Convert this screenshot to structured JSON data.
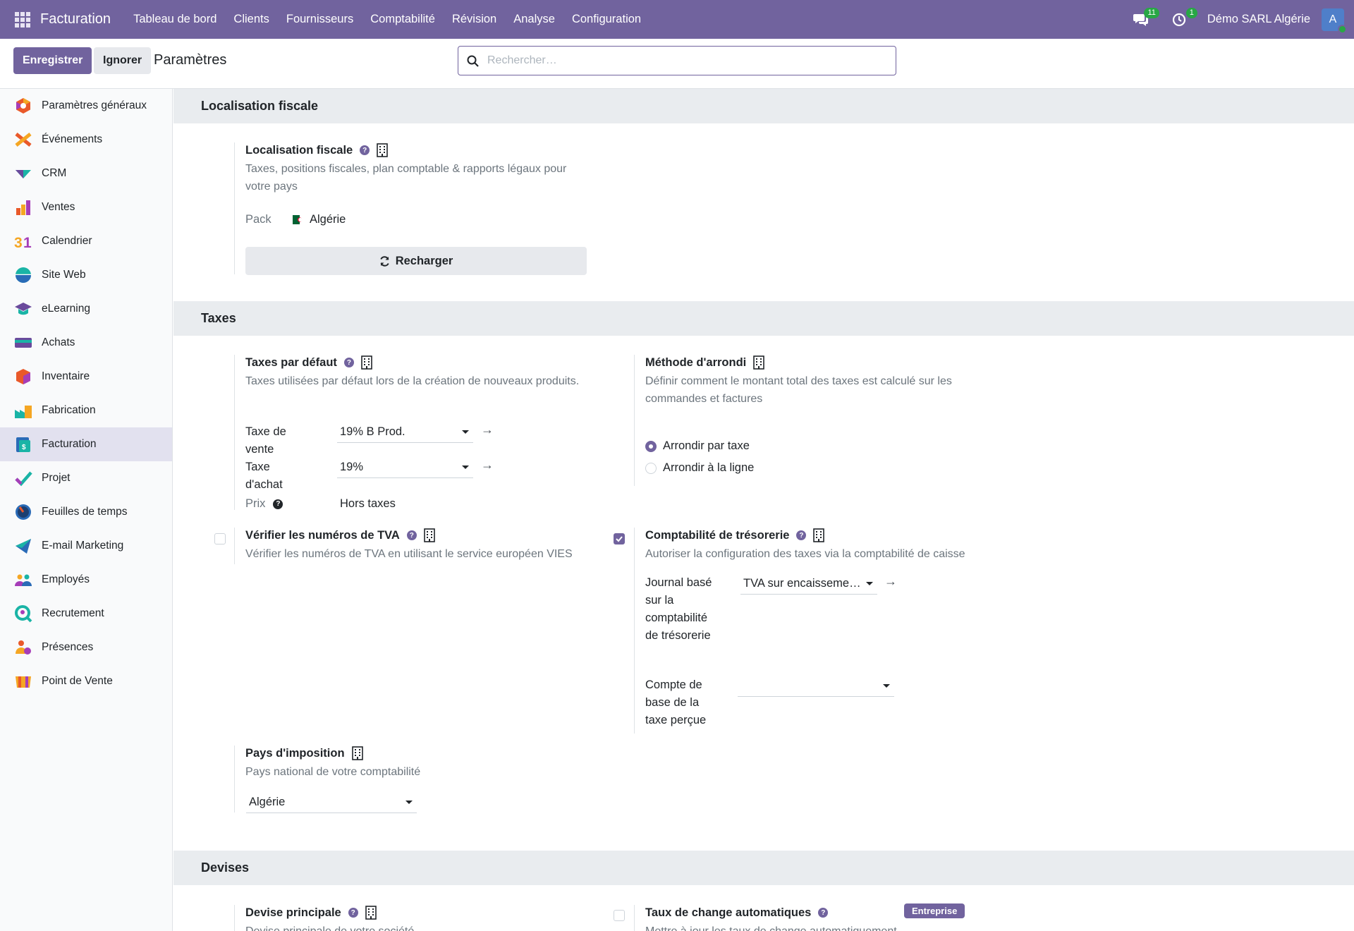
{
  "navbar": {
    "app_name": "Facturation",
    "menu": [
      "Tableau de bord",
      "Clients",
      "Fournisseurs",
      "Comptabilité",
      "Révision",
      "Analyse",
      "Configuration"
    ],
    "messages_count": "11",
    "activities_count": "1",
    "company": "Démo SARL Algérie",
    "avatar_letter": "A",
    "colors": {
      "navbar": "#71639e",
      "badge": "#28a745"
    }
  },
  "control": {
    "save_label": "Enregistrer",
    "discard_label": "Ignorer",
    "title": "Paramètres",
    "search_placeholder": "Rechercher…"
  },
  "sidebar": {
    "items": [
      {
        "label": "Paramètres généraux",
        "icon": "settings-hexagon-icon"
      },
      {
        "label": "Événements",
        "icon": "events-icon"
      },
      {
        "label": "CRM",
        "icon": "crm-icon"
      },
      {
        "label": "Ventes",
        "icon": "sales-chart-icon"
      },
      {
        "label": "Calendrier",
        "icon": "calendar-31-icon"
      },
      {
        "label": "Site Web",
        "icon": "website-icon"
      },
      {
        "label": "eLearning",
        "icon": "graduation-cap-icon"
      },
      {
        "label": "Achats",
        "icon": "purchase-card-icon"
      },
      {
        "label": "Inventaire",
        "icon": "inventory-box-icon"
      },
      {
        "label": "Fabrication",
        "icon": "factory-icon"
      },
      {
        "label": "Facturation",
        "icon": "invoicing-icon",
        "active": true
      },
      {
        "label": "Projet",
        "icon": "project-check-icon"
      },
      {
        "label": "Feuilles de temps",
        "icon": "timesheet-clock-icon"
      },
      {
        "label": "E-mail Marketing",
        "icon": "paper-plane-icon"
      },
      {
        "label": "Employés",
        "icon": "employees-icon"
      },
      {
        "label": "Recrutement",
        "icon": "recruitment-magnifier-icon"
      },
      {
        "label": "Présences",
        "icon": "attendance-icon"
      },
      {
        "label": "Point de Vente",
        "icon": "shop-awning-icon"
      }
    ]
  },
  "sections": {
    "fiscal": {
      "header": "Localisation fiscale",
      "title": "Localisation fiscale",
      "desc": "Taxes, positions fiscales, plan comptable & rapports légaux pour votre pays",
      "pack_label": "Pack",
      "pack_value": "Algérie",
      "reload_label": "Recharger"
    },
    "taxes": {
      "header": "Taxes",
      "default_taxes": {
        "title": "Taxes par défaut",
        "desc": "Taxes utilisées par défaut lors de la création de nouveaux produits.",
        "sale_label": "Taxe de vente",
        "sale_value": "19% B Prod.",
        "purchase_label": "Taxe d'achat",
        "purchase_value": "19%",
        "price_label": "Prix",
        "price_value": "Hors taxes"
      },
      "rounding": {
        "title": "Méthode d'arrondi",
        "desc": "Définir comment le montant total des taxes est calculé sur les commandes et factures",
        "options": [
          "Arrondir par taxe",
          "Arrondir à la ligne"
        ],
        "selected": "Arrondir par taxe"
      },
      "vat_check": {
        "title": "Vérifier les numéros de TVA",
        "desc": "Vérifier les numéros de TVA en utilisant le service européen VIES",
        "checked": false
      },
      "cash_basis": {
        "title": "Comptabilité de trésorerie",
        "desc": "Autoriser la configuration des taxes via la comptabilité de caisse",
        "checked": true,
        "journal_label": "Journal basé sur la comptabilité de trésorerie",
        "journal_value": "TVA sur encaisseme…",
        "account_label": "Compte de base de la taxe perçue",
        "account_value": ""
      },
      "fiscal_country": {
        "title": "Pays d'imposition",
        "desc": "Pays national de votre comptabilité",
        "value": "Algérie"
      }
    },
    "currencies": {
      "header": "Devises",
      "main_currency": {
        "title": "Devise principale",
        "desc": "Devise principale de votre société"
      },
      "auto_rates": {
        "title": "Taux de change automatiques",
        "desc": "Mettre à jour les taux de change automatiquement",
        "badge": "Entreprise",
        "checked": false
      }
    }
  }
}
